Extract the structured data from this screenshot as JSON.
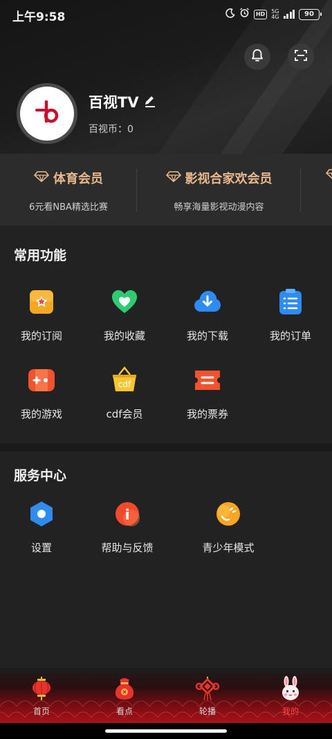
{
  "status_bar": {
    "time": "上午9:58",
    "network": "5G",
    "network_sub": "4G",
    "hd_badge": "HD",
    "battery": "90"
  },
  "profile": {
    "name": "百视TV",
    "coins_label": "百视币：",
    "coins_value": "0",
    "avatar_logo_letter": "b"
  },
  "memberships": [
    {
      "title": "体育会员",
      "subtitle": "6元看NBA精选比赛"
    },
    {
      "title": "影视合家欢会员",
      "subtitle": "畅享海量影视动漫内容"
    },
    {
      "title": "",
      "subtitle": ""
    }
  ],
  "common": {
    "title": "常用功能",
    "items": [
      {
        "label": "我的订阅",
        "icon": "subscription-icon"
      },
      {
        "label": "我的收藏",
        "icon": "favorite-heart-icon"
      },
      {
        "label": "我的下载",
        "icon": "download-cloud-icon"
      },
      {
        "label": "我的订单",
        "icon": "order-list-icon"
      },
      {
        "label": "我的游戏",
        "icon": "gamepad-icon"
      },
      {
        "label": "cdf会员",
        "icon": "cdf-basket-icon",
        "icon_text": "cdf"
      },
      {
        "label": "我的票券",
        "icon": "ticket-icon"
      }
    ]
  },
  "service": {
    "title": "服务中心",
    "items": [
      {
        "label": "设置",
        "icon": "settings-hex-icon"
      },
      {
        "label": "帮助与反馈",
        "icon": "help-info-icon",
        "icon_text": "i"
      },
      {
        "label": "青少年模式",
        "icon": "teen-mode-icon"
      }
    ]
  },
  "bottom_nav": [
    {
      "label": "首页",
      "icon": "lantern-icon"
    },
    {
      "label": "看点",
      "icon": "lucky-bag-icon"
    },
    {
      "label": "轮播",
      "icon": "chinese-knot-icon"
    },
    {
      "label": "我的",
      "icon": "rabbit-icon",
      "active": true
    }
  ],
  "colors": {
    "accent_red": "#ff4b4b",
    "member_gold": "#e8b98d",
    "background": "#222222",
    "brand_red": "#c8102e"
  }
}
